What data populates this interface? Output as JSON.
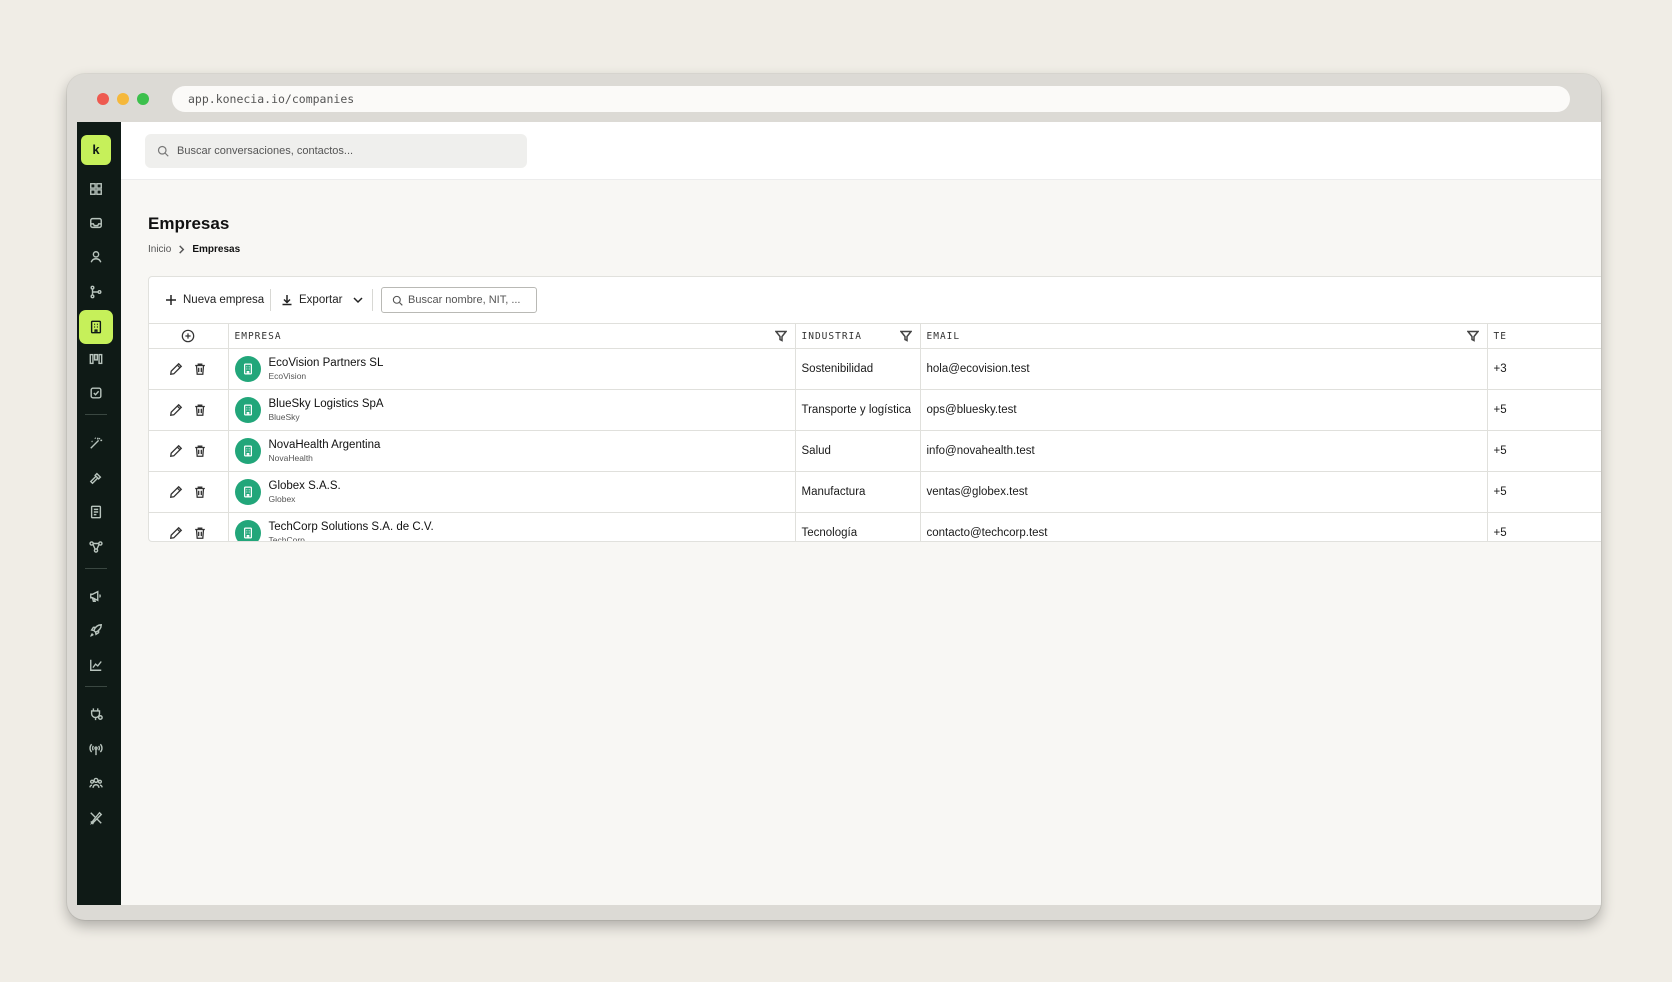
{
  "browser": {
    "url": "app.konecia.io/companies"
  },
  "sidebar": {
    "logo": "k",
    "items": [
      {
        "icon": "grid-icon"
      },
      {
        "icon": "inbox-icon"
      },
      {
        "icon": "user-icon"
      },
      {
        "icon": "flow-icon"
      },
      {
        "icon": "building-icon",
        "active": true
      },
      {
        "icon": "pipeline-icon"
      },
      {
        "icon": "task-icon"
      },
      {
        "icon": "magic-icon"
      },
      {
        "icon": "hammer-icon"
      },
      {
        "icon": "document-icon"
      },
      {
        "icon": "network-icon"
      },
      {
        "icon": "megaphone-icon"
      },
      {
        "icon": "rocket-icon"
      },
      {
        "icon": "chart-icon"
      },
      {
        "icon": "plug-icon"
      },
      {
        "icon": "broadcast-icon"
      },
      {
        "icon": "team-icon"
      },
      {
        "icon": "tools-icon"
      }
    ]
  },
  "topbar": {
    "search_placeholder": "Buscar conversaciones, contactos..."
  },
  "page": {
    "title": "Empresas",
    "breadcrumb": {
      "home": "Inicio",
      "current": "Empresas"
    }
  },
  "toolbar": {
    "new_label": "Nueva empresa",
    "export_label": "Exportar",
    "search_placeholder": "Buscar nombre, NIT, ..."
  },
  "table": {
    "columns": {
      "company": "EMPRESA",
      "industry": "INDUSTRIA",
      "email": "EMAIL",
      "phone": "TE"
    },
    "rows": [
      {
        "name": "EcoVision Partners SL",
        "short": "EcoVision",
        "industry": "Sostenibilidad",
        "email": "hola@ecovision.test",
        "phone": "+3"
      },
      {
        "name": "BlueSky Logistics SpA",
        "short": "BlueSky",
        "industry": "Transporte y logística",
        "email": "ops@bluesky.test",
        "phone": "+5"
      },
      {
        "name": "NovaHealth Argentina",
        "short": "NovaHealth",
        "industry": "Salud",
        "email": "info@novahealth.test",
        "phone": "+5"
      },
      {
        "name": "Globex S.A.S.",
        "short": "Globex",
        "industry": "Manufactura",
        "email": "ventas@globex.test",
        "phone": "+5"
      },
      {
        "name": "TechCorp Solutions S.A. de C.V.",
        "short": "TechCorp",
        "industry": "Tecnología",
        "email": "contacto@techcorp.test",
        "phone": "+5"
      }
    ]
  },
  "colors": {
    "accent": "#c6f05a",
    "sidebar": "#0f1a16",
    "avatar": "#22a67a"
  }
}
